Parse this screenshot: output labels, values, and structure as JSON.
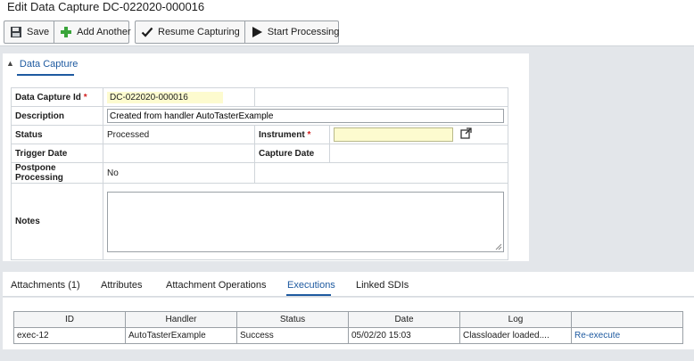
{
  "page": {
    "title": "Edit Data Capture DC-022020-000016"
  },
  "toolbar": {
    "save": "Save",
    "add_another": "Add Another",
    "resume_capturing": "Resume Capturing",
    "start_processing": "Start Processing"
  },
  "section": {
    "title": "Data Capture"
  },
  "form": {
    "id_label": "Data Capture Id",
    "id_value": "DC-022020-000016",
    "required_mark": "*",
    "description_label": "Description",
    "description_value": "Created from handler AutoTasterExample",
    "status_label": "Status",
    "status_value": "Processed",
    "instrument_label": "Instrument",
    "instrument_value": "",
    "trigger_date_label": "Trigger Date",
    "trigger_date_value": "",
    "capture_date_label": "Capture Date",
    "capture_date_value": "",
    "postpone_label": "Postpone Processing",
    "postpone_value": "No",
    "notes_label": "Notes",
    "notes_value": ""
  },
  "tabs": {
    "attachments": "Attachments (1)",
    "attributes": "Attributes",
    "attachment_operations": "Attachment Operations",
    "executions": "Executions",
    "linked_sdis": "Linked SDIs"
  },
  "executions": {
    "headers": {
      "id": "ID",
      "handler": "Handler",
      "status": "Status",
      "date": "Date",
      "log": "Log",
      "action": ""
    },
    "row": {
      "id": "exec-12",
      "handler": "AutoTasterExample",
      "status": "Success",
      "date": "05/02/20 15:03",
      "log": "Classloader loaded....",
      "action": "Re-execute"
    }
  },
  "colors": {
    "accent": "#1e5aa0",
    "required": "#d21f1f",
    "readonly_bg": "#fdfbcf",
    "add_icon": "#3aa43a"
  }
}
